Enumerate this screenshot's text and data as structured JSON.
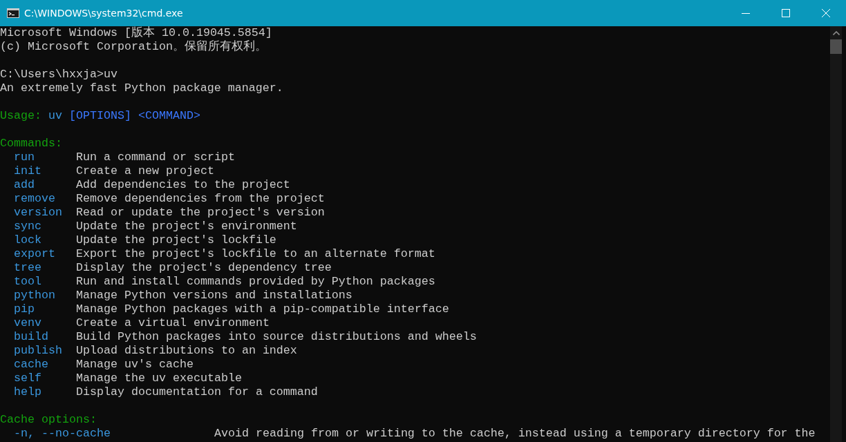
{
  "window": {
    "title": "C:\\WINDOWS\\system32\\cmd.exe"
  },
  "header_lines": [
    "Microsoft Windows [版本 10.0.19045.5854]",
    "(c) Microsoft Corporation。保留所有权利。"
  ],
  "prompt": "C:\\Users\\hxxja>uv",
  "description": "An extremely fast Python package manager.",
  "usage": {
    "label": "Usage:",
    "program": "uv",
    "options": "[OPTIONS]",
    "command": "<COMMAND>"
  },
  "commands": {
    "heading": "Commands:",
    "items": [
      {
        "name": "run",
        "description": "Run a command or script"
      },
      {
        "name": "init",
        "description": "Create a new project"
      },
      {
        "name": "add",
        "description": "Add dependencies to the project"
      },
      {
        "name": "remove",
        "description": "Remove dependencies from the project"
      },
      {
        "name": "version",
        "description": "Read or update the project's version"
      },
      {
        "name": "sync",
        "description": "Update the project's environment"
      },
      {
        "name": "lock",
        "description": "Update the project's lockfile"
      },
      {
        "name": "export",
        "description": "Export the project's lockfile to an alternate format"
      },
      {
        "name": "tree",
        "description": "Display the project's dependency tree"
      },
      {
        "name": "tool",
        "description": "Run and install commands provided by Python packages"
      },
      {
        "name": "python",
        "description": "Manage Python versions and installations"
      },
      {
        "name": "pip",
        "description": "Manage Python packages with a pip-compatible interface"
      },
      {
        "name": "venv",
        "description": "Create a virtual environment"
      },
      {
        "name": "build",
        "description": "Build Python packages into source distributions and wheels"
      },
      {
        "name": "publish",
        "description": "Upload distributions to an index"
      },
      {
        "name": "cache",
        "description": "Manage uv's cache"
      },
      {
        "name": "self",
        "description": "Manage the uv executable"
      },
      {
        "name": "help",
        "description": "Display documentation for a command"
      }
    ]
  },
  "cache_options": {
    "heading": "Cache options:",
    "items": [
      {
        "flag": "-n, --no-cache",
        "description": "Avoid reading from or writing to the cache, instead using a temporary directory for the"
      }
    ]
  }
}
